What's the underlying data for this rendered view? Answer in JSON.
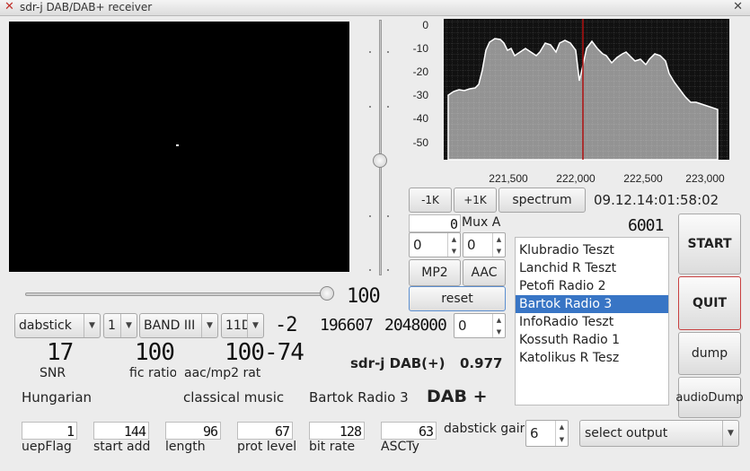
{
  "window": {
    "title": "sdr-j DAB/DAB+ receiver"
  },
  "scope": {
    "slider_value": "100"
  },
  "spectrum": {
    "y_ticks": [
      "0",
      "-10",
      "-20",
      "-30",
      "-40",
      "-50"
    ],
    "x_ticks": [
      "221,500",
      "222,000",
      "222,500",
      "223,000"
    ],
    "marker_color": "#b01010",
    "buttons": {
      "minus1k": "-1K",
      "plus1k": "+1K",
      "spectrum": "spectrum"
    },
    "datetime": "09.12.14:01:58:02"
  },
  "ensemble": {
    "count": "0",
    "name": "Mux A",
    "id": "6001"
  },
  "spins": {
    "left": "0",
    "right": "0",
    "offset": "0",
    "gain": "6"
  },
  "modes": {
    "mp2": "MP2",
    "aac": "AAC",
    "reset": "reset"
  },
  "controls": {
    "device": "dabstick",
    "mode": "1",
    "band": "BAND III",
    "channel": "11D",
    "freq_corr": "-2",
    "val1": "196607",
    "val2": "2048000"
  },
  "stats": {
    "snr": "17",
    "snr_label": "SNR",
    "fic": "100",
    "fic_label": "fic ratio",
    "aac": "100",
    "aac_label": "aac/mp2 rat",
    "level": "-74",
    "version_label": "sdr-j DAB(+)",
    "version": "0.977"
  },
  "program": {
    "language": "Hungarian",
    "type": "classical music",
    "name": "Bartok Radio 3",
    "dab": "DAB +"
  },
  "services": [
    "Klubradio Teszt",
    "Lanchid R Teszt",
    "Petofi Radio 2",
    "Bartok Radio 3",
    "InfoRadio Teszt",
    "Kossuth Radio 1",
    "Katolikus R Tesz"
  ],
  "selected_service": "Bartok Radio 3",
  "side_buttons": {
    "start": "START",
    "quit": "QUIT",
    "dump": "dump",
    "audiodump": "audioDump"
  },
  "fields": [
    {
      "value": "1",
      "label": "uepFlag"
    },
    {
      "value": "144",
      "label": "start add"
    },
    {
      "value": "96",
      "label": "length"
    },
    {
      "value": "67",
      "label": "prot level"
    },
    {
      "value": "128",
      "label": "bit rate"
    },
    {
      "value": "63",
      "label": "ASCTy"
    }
  ],
  "gain_label": "dabstick gain",
  "output": {
    "selected": "select output"
  }
}
